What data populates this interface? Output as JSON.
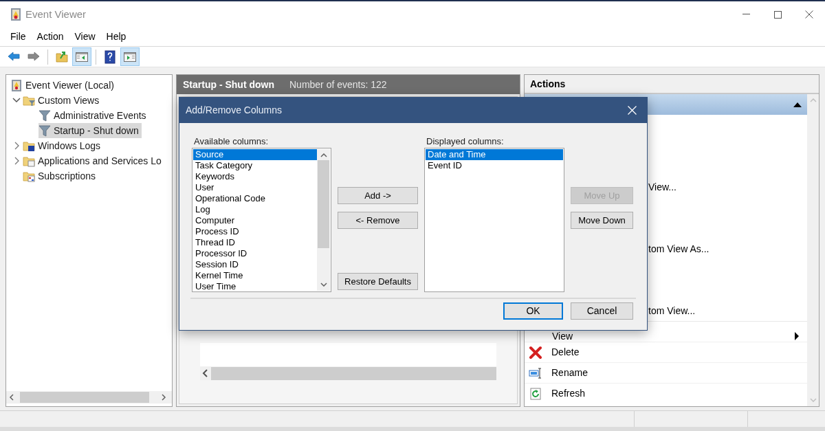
{
  "window": {
    "title": "Event Viewer"
  },
  "menu": [
    "File",
    "Action",
    "View",
    "Help"
  ],
  "toolbar": {
    "groups": [
      [
        {
          "kind": "back",
          "pressed": false
        },
        {
          "kind": "forward",
          "pressed": false
        }
      ],
      [
        {
          "kind": "folder-up",
          "pressed": false
        },
        {
          "kind": "pane",
          "pressed": true
        }
      ],
      [
        {
          "kind": "help",
          "pressed": false
        },
        {
          "kind": "action-pane",
          "pressed": true
        }
      ]
    ]
  },
  "tree": [
    {
      "label": "Event Viewer (Local)",
      "kind": "viewer",
      "selected": false,
      "children": [
        {
          "label": "Custom Views",
          "kind": "folder-filter",
          "selected": false,
          "expanded": true,
          "children": [
            {
              "label": "Administrative Events",
              "kind": "filter",
              "selected": false
            },
            {
              "label": "Startup - Shut down",
              "kind": "filter",
              "selected": true
            }
          ]
        },
        {
          "label": "Windows Logs",
          "kind": "folder-windows",
          "selected": false,
          "expanded": false
        },
        {
          "label": "Applications and Services Lo",
          "kind": "folder-doc",
          "selected": false,
          "expanded": false
        },
        {
          "label": "Subscriptions",
          "kind": "folder-sub",
          "selected": false
        }
      ]
    }
  ],
  "center": {
    "title": "Startup - Shut down",
    "event_count": "Number of events: 122"
  },
  "actions": {
    "title": "Actions",
    "items": [
      {
        "kind": "partial",
        "label": "View..."
      },
      {
        "kind": "partial",
        "label": "tom View As..."
      },
      {
        "kind": "partial",
        "label": "tom View..."
      },
      {
        "kind": "submenu",
        "label": "View"
      },
      {
        "kind": "delete",
        "label": "Delete"
      },
      {
        "kind": "rename",
        "label": "Rename"
      },
      {
        "kind": "refresh",
        "label": "Refresh"
      }
    ]
  },
  "dialog": {
    "title": "Add/Remove Columns",
    "available_label": "Available columns:",
    "available": [
      {
        "label": "Source",
        "selected": true
      },
      {
        "label": "Task Category",
        "selected": false
      },
      {
        "label": "Keywords",
        "selected": false
      },
      {
        "label": "User",
        "selected": false
      },
      {
        "label": "Operational Code",
        "selected": false
      },
      {
        "label": "Log",
        "selected": false
      },
      {
        "label": "Computer",
        "selected": false
      },
      {
        "label": "Process ID",
        "selected": false
      },
      {
        "label": "Thread ID",
        "selected": false
      },
      {
        "label": "Processor ID",
        "selected": false
      },
      {
        "label": "Session ID",
        "selected": false
      },
      {
        "label": "Kernel Time",
        "selected": false
      },
      {
        "label": "User Time",
        "selected": false
      }
    ],
    "displayed_label": "Displayed columns:",
    "displayed": [
      {
        "label": "Date and Time",
        "selected": true
      },
      {
        "label": "Event ID",
        "selected": false
      }
    ],
    "add_button": {
      "label": "Add ->",
      "disabled": false
    },
    "remove_button": {
      "label": "<- Remove",
      "disabled": false
    },
    "restore_button": {
      "label": "Restore Defaults",
      "disabled": false
    },
    "order_buttons": [
      {
        "label": "Move Up",
        "disabled": true
      },
      {
        "label": "Move Down",
        "disabled": false
      }
    ],
    "footer_buttons": [
      {
        "label": "OK",
        "default": true
      },
      {
        "label": "Cancel",
        "default": false
      }
    ]
  }
}
